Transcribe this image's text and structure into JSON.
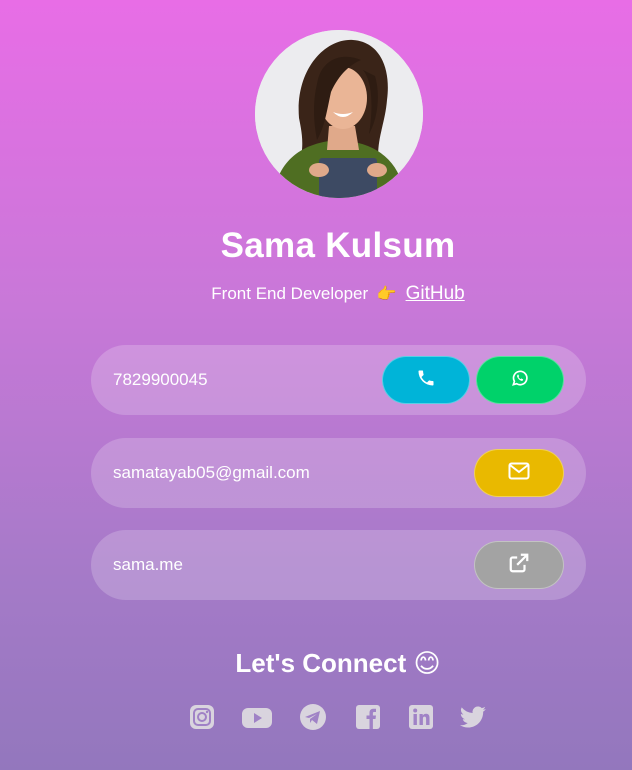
{
  "profile": {
    "name": "Sama Kulsum",
    "role": "Front End Developer",
    "role_emoji": "👉",
    "github_label": "GitHub"
  },
  "contacts": {
    "phone": {
      "value": "7829900045",
      "call_icon": "phone-icon",
      "whatsapp_icon": "whatsapp-icon"
    },
    "email": {
      "value": "samatayab05@gmail.com",
      "icon": "envelope-icon"
    },
    "website": {
      "value": "sama.me",
      "icon": "external-link-icon"
    }
  },
  "connect": {
    "title": "Let's Connect",
    "emoji": "😊",
    "networks": [
      "instagram",
      "youtube",
      "telegram",
      "facebook",
      "linkedin",
      "twitter"
    ]
  },
  "colors": {
    "call_button": "#00b4d8",
    "whatsapp_button": "#00d26a",
    "email_button": "#e9b900",
    "website_button": "#a3a3a3",
    "social_icons": "#d9d4de"
  }
}
